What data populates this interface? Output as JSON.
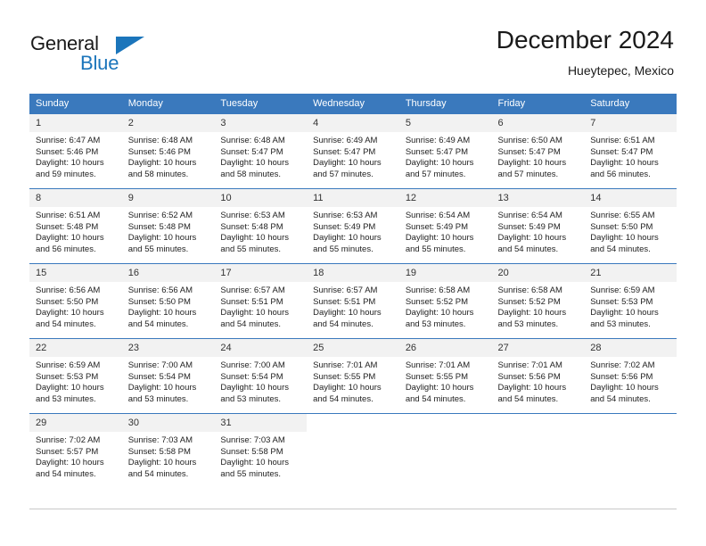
{
  "brand": {
    "name_part1": "General",
    "name_part2": "Blue",
    "accent_color": "#1b75bb",
    "triangle_icon": "triangle-right-icon"
  },
  "header": {
    "title": "December 2024",
    "location": "Hueytepec, Mexico"
  },
  "theme": {
    "header_row_bg": "#3a79bd",
    "daynum_bg": "#f2f2f2",
    "week_separator": "#3a79bd",
    "text": "#222222"
  },
  "weekday_headers": [
    "Sunday",
    "Monday",
    "Tuesday",
    "Wednesday",
    "Thursday",
    "Friday",
    "Saturday"
  ],
  "labels": {
    "sunrise_prefix": "Sunrise:",
    "sunset_prefix": "Sunset:",
    "daylight_prefix": "Daylight:"
  },
  "weeks": [
    [
      {
        "day": "1",
        "sunrise": "Sunrise: 6:47 AM",
        "sunset": "Sunset: 5:46 PM",
        "daylight_line1": "Daylight: 10 hours",
        "daylight_line2": "and 59 minutes."
      },
      {
        "day": "2",
        "sunrise": "Sunrise: 6:48 AM",
        "sunset": "Sunset: 5:46 PM",
        "daylight_line1": "Daylight: 10 hours",
        "daylight_line2": "and 58 minutes."
      },
      {
        "day": "3",
        "sunrise": "Sunrise: 6:48 AM",
        "sunset": "Sunset: 5:47 PM",
        "daylight_line1": "Daylight: 10 hours",
        "daylight_line2": "and 58 minutes."
      },
      {
        "day": "4",
        "sunrise": "Sunrise: 6:49 AM",
        "sunset": "Sunset: 5:47 PM",
        "daylight_line1": "Daylight: 10 hours",
        "daylight_line2": "and 57 minutes."
      },
      {
        "day": "5",
        "sunrise": "Sunrise: 6:49 AM",
        "sunset": "Sunset: 5:47 PM",
        "daylight_line1": "Daylight: 10 hours",
        "daylight_line2": "and 57 minutes."
      },
      {
        "day": "6",
        "sunrise": "Sunrise: 6:50 AM",
        "sunset": "Sunset: 5:47 PM",
        "daylight_line1": "Daylight: 10 hours",
        "daylight_line2": "and 57 minutes."
      },
      {
        "day": "7",
        "sunrise": "Sunrise: 6:51 AM",
        "sunset": "Sunset: 5:47 PM",
        "daylight_line1": "Daylight: 10 hours",
        "daylight_line2": "and 56 minutes."
      }
    ],
    [
      {
        "day": "8",
        "sunrise": "Sunrise: 6:51 AM",
        "sunset": "Sunset: 5:48 PM",
        "daylight_line1": "Daylight: 10 hours",
        "daylight_line2": "and 56 minutes."
      },
      {
        "day": "9",
        "sunrise": "Sunrise: 6:52 AM",
        "sunset": "Sunset: 5:48 PM",
        "daylight_line1": "Daylight: 10 hours",
        "daylight_line2": "and 55 minutes."
      },
      {
        "day": "10",
        "sunrise": "Sunrise: 6:53 AM",
        "sunset": "Sunset: 5:48 PM",
        "daylight_line1": "Daylight: 10 hours",
        "daylight_line2": "and 55 minutes."
      },
      {
        "day": "11",
        "sunrise": "Sunrise: 6:53 AM",
        "sunset": "Sunset: 5:49 PM",
        "daylight_line1": "Daylight: 10 hours",
        "daylight_line2": "and 55 minutes."
      },
      {
        "day": "12",
        "sunrise": "Sunrise: 6:54 AM",
        "sunset": "Sunset: 5:49 PM",
        "daylight_line1": "Daylight: 10 hours",
        "daylight_line2": "and 55 minutes."
      },
      {
        "day": "13",
        "sunrise": "Sunrise: 6:54 AM",
        "sunset": "Sunset: 5:49 PM",
        "daylight_line1": "Daylight: 10 hours",
        "daylight_line2": "and 54 minutes."
      },
      {
        "day": "14",
        "sunrise": "Sunrise: 6:55 AM",
        "sunset": "Sunset: 5:50 PM",
        "daylight_line1": "Daylight: 10 hours",
        "daylight_line2": "and 54 minutes."
      }
    ],
    [
      {
        "day": "15",
        "sunrise": "Sunrise: 6:56 AM",
        "sunset": "Sunset: 5:50 PM",
        "daylight_line1": "Daylight: 10 hours",
        "daylight_line2": "and 54 minutes."
      },
      {
        "day": "16",
        "sunrise": "Sunrise: 6:56 AM",
        "sunset": "Sunset: 5:50 PM",
        "daylight_line1": "Daylight: 10 hours",
        "daylight_line2": "and 54 minutes."
      },
      {
        "day": "17",
        "sunrise": "Sunrise: 6:57 AM",
        "sunset": "Sunset: 5:51 PM",
        "daylight_line1": "Daylight: 10 hours",
        "daylight_line2": "and 54 minutes."
      },
      {
        "day": "18",
        "sunrise": "Sunrise: 6:57 AM",
        "sunset": "Sunset: 5:51 PM",
        "daylight_line1": "Daylight: 10 hours",
        "daylight_line2": "and 54 minutes."
      },
      {
        "day": "19",
        "sunrise": "Sunrise: 6:58 AM",
        "sunset": "Sunset: 5:52 PM",
        "daylight_line1": "Daylight: 10 hours",
        "daylight_line2": "and 53 minutes."
      },
      {
        "day": "20",
        "sunrise": "Sunrise: 6:58 AM",
        "sunset": "Sunset: 5:52 PM",
        "daylight_line1": "Daylight: 10 hours",
        "daylight_line2": "and 53 minutes."
      },
      {
        "day": "21",
        "sunrise": "Sunrise: 6:59 AM",
        "sunset": "Sunset: 5:53 PM",
        "daylight_line1": "Daylight: 10 hours",
        "daylight_line2": "and 53 minutes."
      }
    ],
    [
      {
        "day": "22",
        "sunrise": "Sunrise: 6:59 AM",
        "sunset": "Sunset: 5:53 PM",
        "daylight_line1": "Daylight: 10 hours",
        "daylight_line2": "and 53 minutes."
      },
      {
        "day": "23",
        "sunrise": "Sunrise: 7:00 AM",
        "sunset": "Sunset: 5:54 PM",
        "daylight_line1": "Daylight: 10 hours",
        "daylight_line2": "and 53 minutes."
      },
      {
        "day": "24",
        "sunrise": "Sunrise: 7:00 AM",
        "sunset": "Sunset: 5:54 PM",
        "daylight_line1": "Daylight: 10 hours",
        "daylight_line2": "and 53 minutes."
      },
      {
        "day": "25",
        "sunrise": "Sunrise: 7:01 AM",
        "sunset": "Sunset: 5:55 PM",
        "daylight_line1": "Daylight: 10 hours",
        "daylight_line2": "and 54 minutes."
      },
      {
        "day": "26",
        "sunrise": "Sunrise: 7:01 AM",
        "sunset": "Sunset: 5:55 PM",
        "daylight_line1": "Daylight: 10 hours",
        "daylight_line2": "and 54 minutes."
      },
      {
        "day": "27",
        "sunrise": "Sunrise: 7:01 AM",
        "sunset": "Sunset: 5:56 PM",
        "daylight_line1": "Daylight: 10 hours",
        "daylight_line2": "and 54 minutes."
      },
      {
        "day": "28",
        "sunrise": "Sunrise: 7:02 AM",
        "sunset": "Sunset: 5:56 PM",
        "daylight_line1": "Daylight: 10 hours",
        "daylight_line2": "and 54 minutes."
      }
    ],
    [
      {
        "day": "29",
        "sunrise": "Sunrise: 7:02 AM",
        "sunset": "Sunset: 5:57 PM",
        "daylight_line1": "Daylight: 10 hours",
        "daylight_line2": "and 54 minutes."
      },
      {
        "day": "30",
        "sunrise": "Sunrise: 7:03 AM",
        "sunset": "Sunset: 5:58 PM",
        "daylight_line1": "Daylight: 10 hours",
        "daylight_line2": "and 54 minutes."
      },
      {
        "day": "31",
        "sunrise": "Sunrise: 7:03 AM",
        "sunset": "Sunset: 5:58 PM",
        "daylight_line1": "Daylight: 10 hours",
        "daylight_line2": "and 55 minutes."
      },
      {
        "day": "",
        "sunrise": "",
        "sunset": "",
        "daylight_line1": "",
        "daylight_line2": ""
      },
      {
        "day": "",
        "sunrise": "",
        "sunset": "",
        "daylight_line1": "",
        "daylight_line2": ""
      },
      {
        "day": "",
        "sunrise": "",
        "sunset": "",
        "daylight_line1": "",
        "daylight_line2": ""
      },
      {
        "day": "",
        "sunrise": "",
        "sunset": "",
        "daylight_line1": "",
        "daylight_line2": ""
      }
    ]
  ]
}
